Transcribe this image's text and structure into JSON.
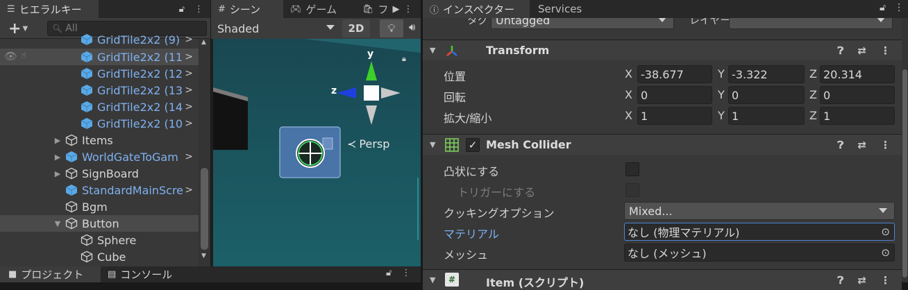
{
  "hierarchy": {
    "tab_label": "ヒエラルキー",
    "add_label": "+",
    "search_placeholder": "All",
    "items": [
      {
        "label": "GridTile2x2 (9)"
      },
      {
        "label": "GridTile2x2 (11"
      },
      {
        "label": "GridTile2x2 (12"
      },
      {
        "label": "GridTile2x2 (13"
      },
      {
        "label": "GridTile2x2 (14"
      },
      {
        "label": "GridTile2x2 (10"
      },
      {
        "label": "Items"
      },
      {
        "label": "WorldGateToGam"
      },
      {
        "label": "SignBoard"
      },
      {
        "label": "StandardMainScre"
      },
      {
        "label": "Bgm"
      },
      {
        "label": "Button"
      },
      {
        "label": "Sphere"
      },
      {
        "label": "Cube"
      }
    ]
  },
  "scene": {
    "tab_scene": "シーン",
    "tab_game": "ゲーム",
    "tab_more": "フ",
    "shading_mode": "Shaded",
    "mode_2d": "2D",
    "gizmo_y": "y",
    "gizmo_z": "z",
    "persp_label": "Persp"
  },
  "bottom_tabs": {
    "project": "プロジェクト",
    "console": "コンソール"
  },
  "inspector": {
    "tab_label": "インスペクター",
    "services_tab": "Services",
    "tag_label": "タグ",
    "tag_value": "Untagged",
    "layer_label": "レイヤー",
    "transform": {
      "title": "Transform",
      "position_label": "位置",
      "rotation_label": "回転",
      "scale_label": "拡大/縮小",
      "position": {
        "x": "-38.677",
        "y": "-3.322",
        "z": "20.314"
      },
      "rotation": {
        "x": "0",
        "y": "0",
        "z": "0"
      },
      "scale": {
        "x": "1",
        "y": "1",
        "z": "1"
      },
      "axis_x": "X",
      "axis_y": "Y",
      "axis_z": "Z"
    },
    "mesh_collider": {
      "title": "Mesh Collider",
      "convex_label": "凸状にする",
      "trigger_label": "トリガーにする",
      "cooking_label": "クッキングオプション",
      "cooking_value": "Mixed...",
      "material_label": "マテリアル",
      "material_value": "なし (物理マテリアル)",
      "mesh_label": "メッシュ",
      "mesh_value": "なし (メッシュ)"
    },
    "item_script": {
      "title": "Item (スクリプト)"
    }
  }
}
